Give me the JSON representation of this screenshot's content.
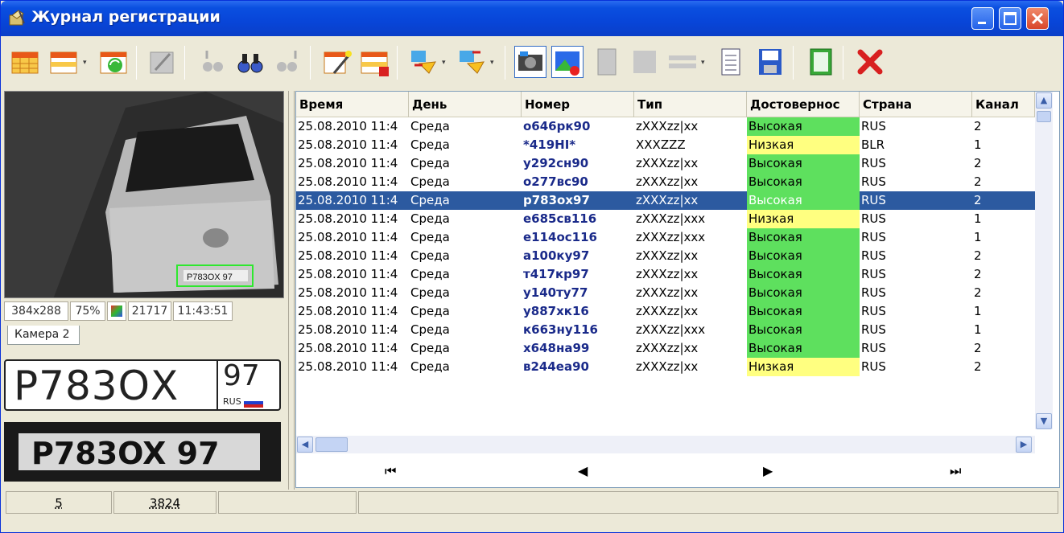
{
  "window": {
    "title": "Журнал регистрации"
  },
  "colors": {
    "selection": "#2c5aa0",
    "high": "#5ee05e",
    "low": "#ffff80",
    "titlebar": "#0a4fe0"
  },
  "toolbar": {
    "icons": [
      "table-grid-icon",
      "table-dropdown-icon",
      "refresh-table-icon",
      "edit-icon",
      "find-prev-icon",
      "find-icon",
      "find-next-icon",
      "wizard-icon",
      "table-delete-icon",
      "export-icon",
      "import-icon",
      "camera-snapshot-icon",
      "add-image-icon",
      "document-icon",
      "square-icon",
      "lines-icon",
      "list-icon",
      "save-icon",
      "notebook-icon",
      "close-icon"
    ]
  },
  "left": {
    "image_size": "384x288",
    "zoom": "75%",
    "frame": "21717",
    "time": "11:43:51",
    "camera_tab": "Камера 2",
    "plate": {
      "main": "Р783ОХ",
      "region": "97",
      "country": "RUS"
    },
    "camera_plate_text": "P783OX 97"
  },
  "grid": {
    "columns": [
      "Время",
      "День",
      "Номер",
      "Тип",
      "Достовернос",
      "Страна",
      "Канал"
    ],
    "rows": [
      {
        "time": "25.08.2010 11:4",
        "day": "Среда",
        "number": "о646рк90",
        "type": "zXXXzz|xx",
        "conf": "Высокая",
        "country": "RUS",
        "channel": "2"
      },
      {
        "time": "25.08.2010 11:4",
        "day": "Среда",
        "number": "*419НI*",
        "type": "XXXZZZ",
        "conf": "Низкая",
        "country": "BLR",
        "channel": "1"
      },
      {
        "time": "25.08.2010 11:4",
        "day": "Среда",
        "number": "у292сн90",
        "type": "zXXXzz|xx",
        "conf": "Высокая",
        "country": "RUS",
        "channel": "2"
      },
      {
        "time": "25.08.2010 11:4",
        "day": "Среда",
        "number": "о277вс90",
        "type": "zXXXzz|xx",
        "conf": "Высокая",
        "country": "RUS",
        "channel": "2"
      },
      {
        "time": "25.08.2010 11:4",
        "day": "Среда",
        "number": "р783ох97",
        "type": "zXXXzz|xx",
        "conf": "Высокая",
        "country": "RUS",
        "channel": "2"
      },
      {
        "time": "25.08.2010 11:4",
        "day": "Среда",
        "number": "е685св116",
        "type": "zXXXzz|xxx",
        "conf": "Низкая",
        "country": "RUS",
        "channel": "1"
      },
      {
        "time": "25.08.2010 11:4",
        "day": "Среда",
        "number": "е114ос116",
        "type": "zXXXzz|xxx",
        "conf": "Высокая",
        "country": "RUS",
        "channel": "1"
      },
      {
        "time": "25.08.2010 11:4",
        "day": "Среда",
        "number": "а100ку97",
        "type": "zXXXzz|xx",
        "conf": "Высокая",
        "country": "RUS",
        "channel": "2"
      },
      {
        "time": "25.08.2010 11:4",
        "day": "Среда",
        "number": "т417кр97",
        "type": "zXXXzz|xx",
        "conf": "Высокая",
        "country": "RUS",
        "channel": "2"
      },
      {
        "time": "25.08.2010 11:4",
        "day": "Среда",
        "number": "у140ту77",
        "type": "zXXXzz|xx",
        "conf": "Высокая",
        "country": "RUS",
        "channel": "2"
      },
      {
        "time": "25.08.2010 11:4",
        "day": "Среда",
        "number": "у887хк16",
        "type": "zXXXzz|xx",
        "conf": "Высокая",
        "country": "RUS",
        "channel": "1"
      },
      {
        "time": "25.08.2010 11:4",
        "day": "Среда",
        "number": "к663ну116",
        "type": "zXXXzz|xxx",
        "conf": "Высокая",
        "country": "RUS",
        "channel": "1"
      },
      {
        "time": "25.08.2010 11:4",
        "day": "Среда",
        "number": "х648на99",
        "type": "zXXXzz|xx",
        "conf": "Высокая",
        "country": "RUS",
        "channel": "2"
      },
      {
        "time": "25.08.2010 11:4",
        "day": "Среда",
        "number": "в244еа90",
        "type": "zXXXzz|xx",
        "conf": "Низкая",
        "country": "RUS",
        "channel": "2"
      }
    ],
    "selected_row": 4,
    "nav": {
      "first": "⏮",
      "prev": "◀",
      "next": "▶",
      "last": "⏭"
    }
  },
  "statusbar": {
    "count": "5",
    "total": "3824"
  }
}
